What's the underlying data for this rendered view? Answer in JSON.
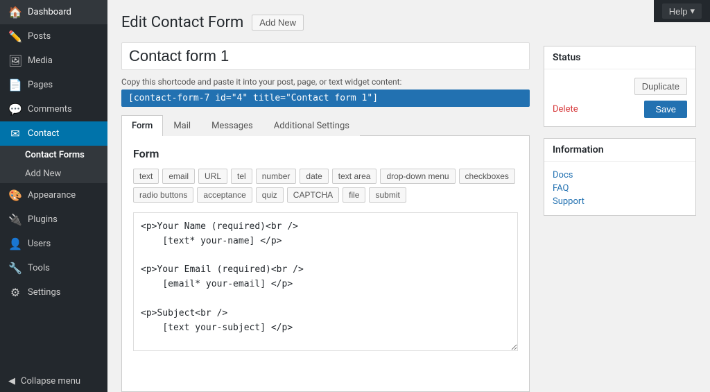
{
  "topbar": {
    "help_label": "Help",
    "help_arrow": "▾"
  },
  "sidebar": {
    "items": [
      {
        "id": "dashboard",
        "label": "Dashboard",
        "icon": "🏠",
        "active": false
      },
      {
        "id": "posts",
        "label": "Posts",
        "icon": "📝",
        "active": false
      },
      {
        "id": "media",
        "label": "Media",
        "icon": "🖼",
        "active": false
      },
      {
        "id": "pages",
        "label": "Pages",
        "icon": "📄",
        "active": false
      },
      {
        "id": "comments",
        "label": "Comments",
        "icon": "💬",
        "active": false
      },
      {
        "id": "contact",
        "label": "Contact",
        "icon": "✉",
        "active": true
      }
    ],
    "sub_items": [
      {
        "id": "contact-forms",
        "label": "Contact Forms",
        "active": true
      },
      {
        "id": "add-new",
        "label": "Add New",
        "active": false
      }
    ],
    "lower_items": [
      {
        "id": "appearance",
        "label": "Appearance",
        "icon": "🎨"
      },
      {
        "id": "plugins",
        "label": "Plugins",
        "icon": "🔌"
      },
      {
        "id": "users",
        "label": "Users",
        "icon": "👤"
      },
      {
        "id": "tools",
        "label": "Tools",
        "icon": "🔧"
      },
      {
        "id": "settings",
        "label": "Settings",
        "icon": "⚙"
      }
    ],
    "collapse_label": "Collapse menu",
    "collapse_icon": "◀"
  },
  "page": {
    "title": "Edit Contact Form",
    "add_new_label": "Add New",
    "form_name": "Contact form 1",
    "shortcode_label": "Copy this shortcode and paste it into your post, page, or text widget content:",
    "shortcode_value": "[contact-form-7 id=\"4\" title=\"Contact form 1\"]"
  },
  "tabs": [
    {
      "id": "form",
      "label": "Form",
      "active": true
    },
    {
      "id": "mail",
      "label": "Mail",
      "active": false
    },
    {
      "id": "messages",
      "label": "Messages",
      "active": false
    },
    {
      "id": "additional-settings",
      "label": "Additional Settings",
      "active": false
    }
  ],
  "form_editor": {
    "title": "Form",
    "tag_buttons": [
      "text",
      "email",
      "URL",
      "tel",
      "number",
      "date",
      "text area",
      "drop-down menu",
      "checkboxes",
      "radio buttons",
      "acceptance",
      "quiz",
      "CAPTCHA",
      "file",
      "submit"
    ],
    "code": "<p>Your Name (required)<br />\n    [text* your-name] </p>\n\n<p>Your Email (required)<br />\n    [email* your-email] </p>\n\n<p>Subject<br />\n    [text your-subject] </p>\n\n<p>Your Message<br />\n    [textarea your-message] </p>\n\n<p>[submit \"Send\"]</p>"
  },
  "status_box": {
    "title": "Status",
    "duplicate_label": "Duplicate",
    "delete_label": "Delete",
    "save_label": "Save"
  },
  "info_box": {
    "title": "Information",
    "links": [
      {
        "label": "Docs"
      },
      {
        "label": "FAQ"
      },
      {
        "label": "Support"
      }
    ]
  }
}
